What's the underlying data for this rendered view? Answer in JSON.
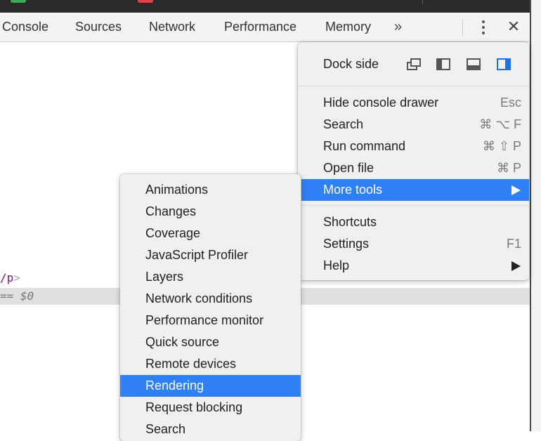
{
  "tabbar": {
    "tabs": [
      {
        "label": "Console"
      },
      {
        "label": "Sources"
      },
      {
        "label": "Network"
      },
      {
        "label": "Performance"
      },
      {
        "label": "Memory"
      }
    ],
    "more_tabs": "»",
    "close_glyph": "✕"
  },
  "elements": {
    "code_tail": "/p",
    "code_gt": ">",
    "selected_suffix": "== $0"
  },
  "main_menu": {
    "dock_side_label": "Dock side",
    "dock_icons": [
      "undock-icon",
      "dock-left-icon",
      "dock-bottom-icon",
      "dock-right-icon"
    ],
    "dock_selected": "dock-right",
    "items": [
      {
        "label": "Hide console drawer",
        "shortcut": "Esc"
      },
      {
        "label": "Search",
        "shortcut": "⌘ ⌥ F"
      },
      {
        "label": "Run command",
        "shortcut": "⌘ ⇧ P"
      },
      {
        "label": "Open file",
        "shortcut": "⌘ P"
      },
      {
        "label": "More tools",
        "shortcut": ""
      },
      {
        "label": "Shortcuts",
        "shortcut": ""
      },
      {
        "label": "Settings",
        "shortcut": "F1"
      },
      {
        "label": "Help",
        "shortcut": ""
      }
    ]
  },
  "more_tools_menu": {
    "items": [
      {
        "label": "Animations"
      },
      {
        "label": "Changes"
      },
      {
        "label": "Coverage"
      },
      {
        "label": "JavaScript Profiler"
      },
      {
        "label": "Layers"
      },
      {
        "label": "Network conditions"
      },
      {
        "label": "Performance monitor"
      },
      {
        "label": "Quick source"
      },
      {
        "label": "Remote devices"
      },
      {
        "label": "Rendering"
      },
      {
        "label": "Request blocking"
      },
      {
        "label": "Search"
      }
    ],
    "highlighted": "Rendering"
  },
  "colors": {
    "highlight": "#2f7ff5",
    "menu_bg": "#f0f0f0",
    "dock_selected": "#1a73e8",
    "code_tag": "#881280"
  }
}
